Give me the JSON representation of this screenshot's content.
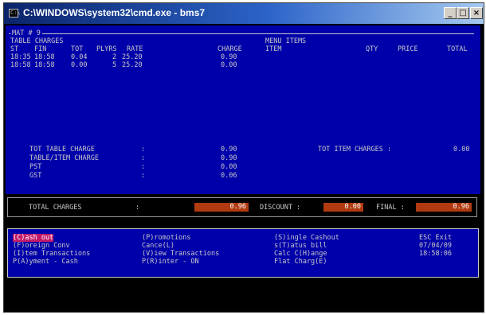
{
  "window": {
    "title": "C:\\WINDOWS\\system32\\cmd.exe - bms7",
    "icon_text": "C:\\",
    "buttons": [
      "_",
      "□",
      "×"
    ]
  },
  "panel": {
    "mat_label": "MAT # 9",
    "table_charges_label": "TABLE CHARGES",
    "menu_items_label": "MENU ITEMS",
    "charges_headers": {
      "st": "ST",
      "fin": "FIN",
      "tot": "TOT",
      "plyrs": "PLYRS",
      "rate": "RATE",
      "charge": "CHARGE"
    },
    "charges_rows": [
      {
        "st": "18:35",
        "fin": "18:58",
        "tot": "0.04",
        "plyrs": "2",
        "rate": "25.20",
        "charge": "0.90"
      },
      {
        "st": "18:58",
        "fin": "18:58",
        "tot": "0.00",
        "plyrs": "5",
        "rate": "25.20",
        "charge": "0.00"
      }
    ],
    "items_headers": {
      "item": "ITEM",
      "qty": "QTY",
      "price": "PRICE",
      "total": "TOTAL"
    },
    "summary": [
      {
        "label": "TOT TABLE CHARGE",
        "sep": ":",
        "value": "0.90"
      },
      {
        "label": "TABLE/ITEM CHARGE",
        "sep": ":",
        "value": "0.90"
      },
      {
        "label": "PST",
        "sep": ":",
        "value": "0.00"
      },
      {
        "label": "GST",
        "sep": ":",
        "value": "0.06"
      }
    ],
    "tot_item_label": "TOT ITEM CHARGES :",
    "tot_item_value": "0.00"
  },
  "totals": {
    "total_label": "TOTAL CHARGES",
    "total_sep": ":",
    "total_value": "0.96",
    "discount_label": "DISCOUNT :",
    "discount_value": "0.00",
    "final_label": "FINAL :",
    "final_value": "0.96",
    "box_color": "#b23a10"
  },
  "menu": {
    "col1": [
      "(C)ash out",
      "(F)oreign Conv",
      "(I)tem Transactions",
      "P(A)yment - Cash"
    ],
    "col2": [
      "(P)romotions",
      "Cance(L)",
      "(V)iew Transactions",
      "P(R)inter - ON"
    ],
    "col3": [
      "(S)ingle Cashout",
      "s(T)atus bill",
      "Calc C(H)ange",
      "Flat Charg(E)"
    ],
    "col4": [
      "ESC Exit",
      "07/04/09",
      "18:58:06"
    ],
    "highlight_color": "#c21a6a"
  }
}
